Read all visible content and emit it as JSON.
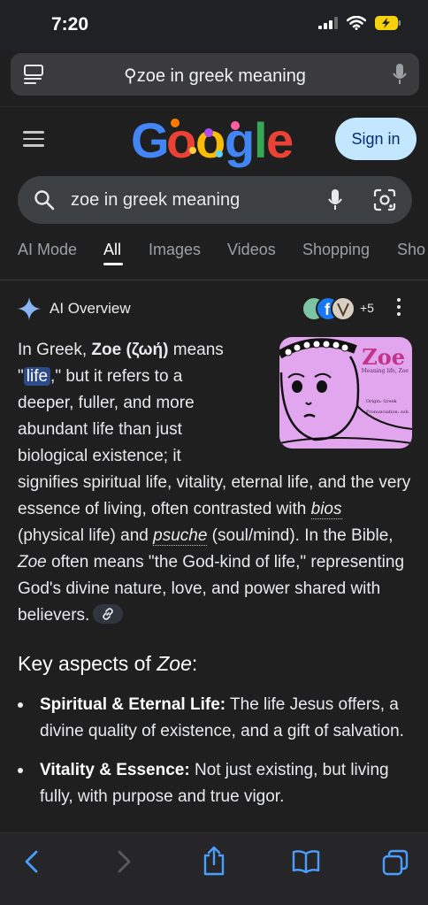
{
  "status": {
    "time": "7:20"
  },
  "address_bar": {
    "query": "zoe in greek meaning"
  },
  "header": {
    "logo_text": "Google",
    "signin_label": "Sign in"
  },
  "search": {
    "query": "zoe in greek meaning"
  },
  "tabs": [
    {
      "label": "AI Mode",
      "active": false
    },
    {
      "label": "All",
      "active": true
    },
    {
      "label": "Images",
      "active": false
    },
    {
      "label": "Videos",
      "active": false
    },
    {
      "label": "Shopping",
      "active": false
    },
    {
      "label": "Sho",
      "active": false
    }
  ],
  "ai_overview": {
    "title": "AI Overview",
    "sources_more": "+5",
    "thumbnail": {
      "title": "Zoe",
      "subtitle": "Meaning life, Zoe",
      "line1": "Origin: Greek",
      "line2": "Pronunciation: zoh"
    },
    "p": {
      "t1": "In Greek, ",
      "b1": "Zoe (ζωή)",
      "t2": " means",
      "t3": "\"",
      "hl": "life",
      "t4": ",\" but it refers to a",
      "t5": "deeper, fuller, and more",
      "t6": "abundant life than just",
      "t7": "biological existence; it",
      "t8": "signifies spiritual life, vitality, eternal life, and the very essence of living, often contrasted with ",
      "i1": "bios",
      "t9": " (physical life) and ",
      "i2": "psuche",
      "t10": " (soul/mind). In the Bible, ",
      "i3": "Zoe",
      "t11": " often means \"the God-kind of life,\" representing God's divine nature, love, and power shared with believers."
    },
    "key_heading_prefix": "Key aspects of ",
    "key_heading_italic": "Zoe",
    "key_heading_suffix": ":",
    "bullets": [
      {
        "bold": "Spiritual & Eternal Life:",
        "text": " The life Jesus offers, a divine quality of existence, and a gift of salvation."
      },
      {
        "bold": "Vitality & Essence:",
        "text": " Not just existing, but living fully, with purpose and true vigor."
      }
    ]
  }
}
